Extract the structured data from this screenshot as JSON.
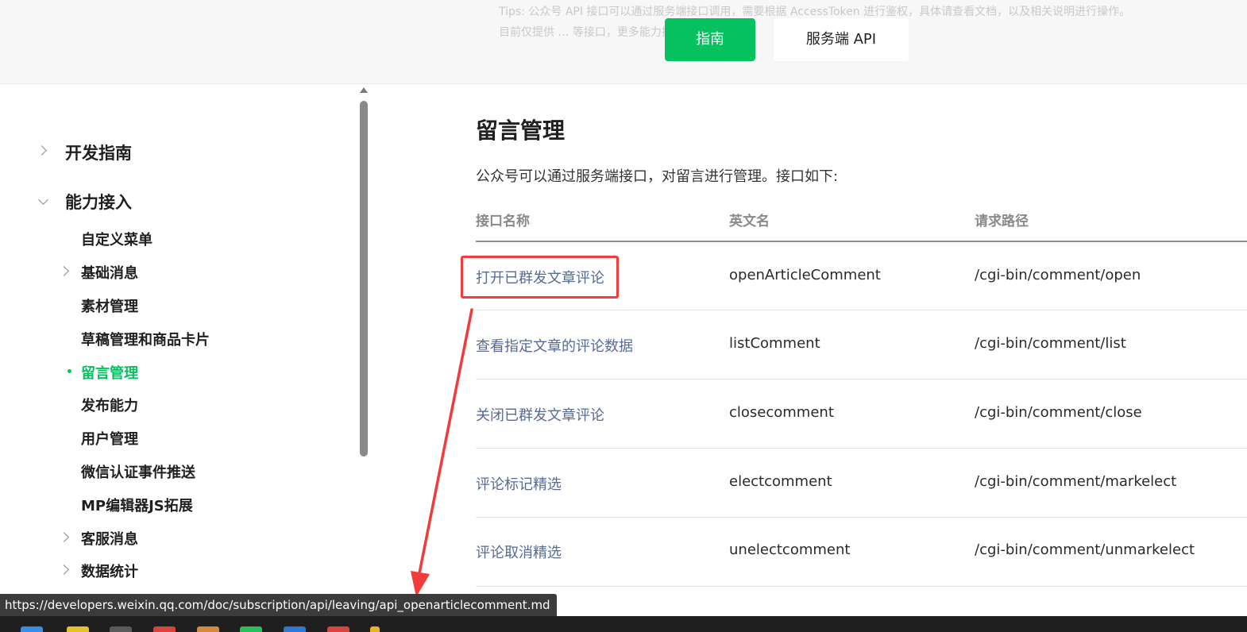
{
  "header": {
    "faded_text": "Tips: 公众号 API 接口可以通过服务端接口调用，需要根据 AccessToken 进行鉴权，具体请查看文档，以及相关说明进行操作。",
    "faded_text_2": "目前仅提供 … 等接口，更多能力持续开放",
    "guide_button": "指南",
    "api_button": "服务端 API"
  },
  "sidebar": {
    "top_items": [
      {
        "label": "开发指南",
        "expanded": false
      },
      {
        "label": "能力接入",
        "expanded": true
      }
    ],
    "sub_items": [
      {
        "label": "自定义菜单",
        "has_children": false,
        "active": false
      },
      {
        "label": "基础消息",
        "has_children": true,
        "active": false
      },
      {
        "label": "素材管理",
        "has_children": false,
        "active": false
      },
      {
        "label": "草稿管理和商品卡片",
        "has_children": false,
        "active": false
      },
      {
        "label": "留言管理",
        "has_children": false,
        "active": true
      },
      {
        "label": "发布能力",
        "has_children": false,
        "active": false
      },
      {
        "label": "用户管理",
        "has_children": false,
        "active": false
      },
      {
        "label": "微信认证事件推送",
        "has_children": false,
        "active": false
      },
      {
        "label": "MP编辑器JS拓展",
        "has_children": false,
        "active": false
      },
      {
        "label": "客服消息",
        "has_children": true,
        "active": false
      },
      {
        "label": "数据统计",
        "has_children": true,
        "active": false
      }
    ]
  },
  "main": {
    "title": "留言管理",
    "intro": "公众号可以通过服务端接口，对留言进行管理。接口如下:",
    "table": {
      "headers": [
        "接口名称",
        "英文名",
        "请求路径"
      ],
      "rows": [
        [
          "打开已群发文章评论",
          "openArticleComment",
          "/cgi-bin/comment/open"
        ],
        [
          "查看指定文章的评论数据",
          "listComment",
          "/cgi-bin/comment/list"
        ],
        [
          "关闭已群发文章评论",
          "closecomment",
          "/cgi-bin/comment/close"
        ],
        [
          "评论标记精选",
          "electcomment",
          "/cgi-bin/comment/markelect"
        ],
        [
          "评论取消精选",
          "unelectcomment",
          "/cgi-bin/comment/unmarkelect"
        ]
      ]
    }
  },
  "status_bar": {
    "url": "https://developers.weixin.qq.com/doc/subscription/api/leaving/api_openarticlecomment.md"
  },
  "colors": {
    "brand_green": "#07c160",
    "link_blue": "#576b95",
    "annotation_red": "#f23b3b"
  }
}
